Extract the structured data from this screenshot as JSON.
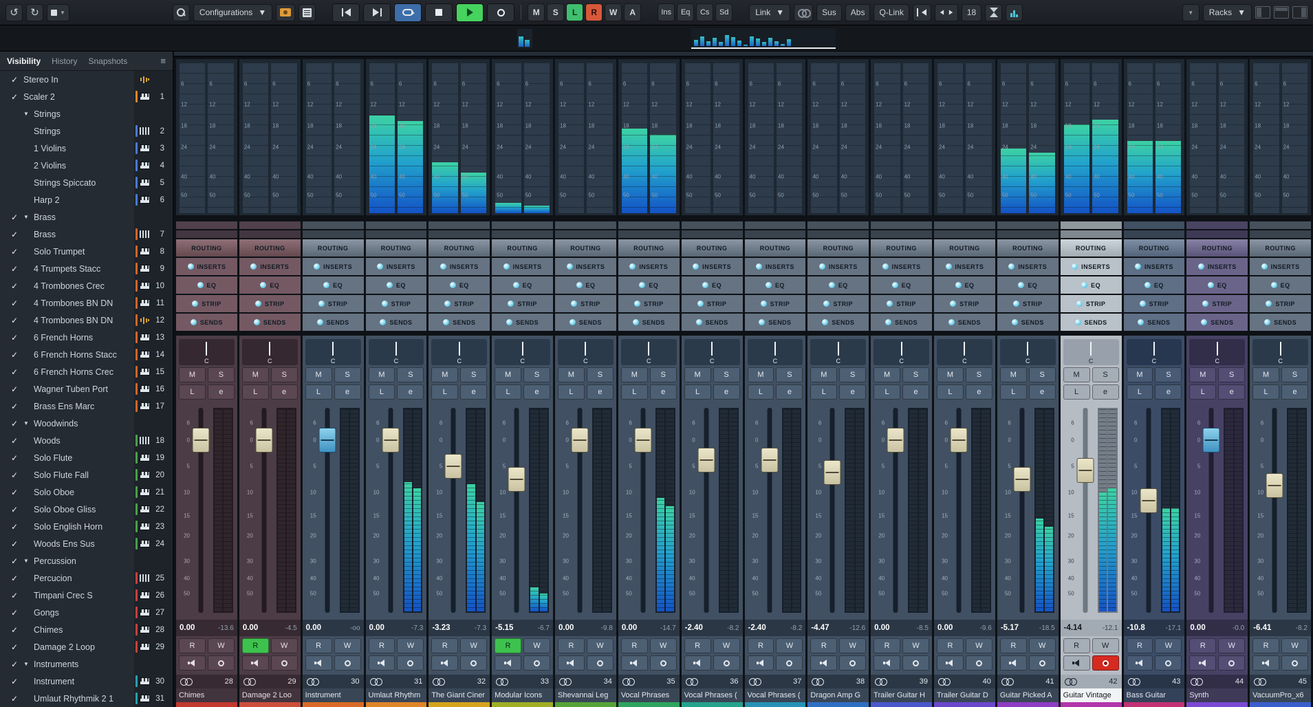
{
  "toolbar": {
    "configurations": "Configurations",
    "link": "Link",
    "sus": "Sus",
    "abs": "Abs",
    "qlink": "Q-Link",
    "position_value": "18",
    "racks": "Racks",
    "channel_btns": [
      {
        "label": "M",
        "state": "off"
      },
      {
        "label": "S",
        "state": "off"
      },
      {
        "label": "L",
        "state": "green"
      },
      {
        "label": "R",
        "state": "orange"
      },
      {
        "label": "W",
        "state": "off"
      },
      {
        "label": "A",
        "state": "off"
      }
    ],
    "rack_btns": [
      "Ins",
      "Eq",
      "Cs",
      "Sd"
    ]
  },
  "minimeters": {
    "small": [
      62,
      40
    ],
    "large": [
      38,
      60,
      30,
      52,
      24,
      68,
      55,
      34,
      10,
      58,
      44,
      24,
      50,
      30,
      14,
      42
    ]
  },
  "sidebar": {
    "tabs": [
      {
        "label": "Visibility",
        "active": true
      },
      {
        "label": "History",
        "active": false
      },
      {
        "label": "Snapshots",
        "active": false
      }
    ],
    "tracks": [
      {
        "name": "Stereo In",
        "num": "",
        "checked": true,
        "folder": false,
        "child": false,
        "icon": "wave",
        "color": ""
      },
      {
        "name": "Scaler 2",
        "num": "1",
        "checked": true,
        "folder": false,
        "child": false,
        "icon": "keys",
        "color": "#e8832a"
      },
      {
        "name": "Strings",
        "num": "",
        "checked": false,
        "folder": true,
        "child": false,
        "icon": "",
        "color": ""
      },
      {
        "name": "Strings",
        "num": "2",
        "checked": false,
        "folder": false,
        "child": true,
        "icon": "organ",
        "color": "#4a7ad0"
      },
      {
        "name": "1 Violins",
        "num": "3",
        "checked": false,
        "folder": false,
        "child": true,
        "icon": "keys",
        "color": "#4a7ad0"
      },
      {
        "name": "2 Violins",
        "num": "4",
        "checked": false,
        "folder": false,
        "child": true,
        "icon": "keys",
        "color": "#4a7ad0"
      },
      {
        "name": "Strings Spiccato",
        "num": "5",
        "checked": false,
        "folder": false,
        "child": true,
        "icon": "keys",
        "color": "#4a7ad0"
      },
      {
        "name": "Harp 2",
        "num": "6",
        "checked": false,
        "folder": false,
        "child": true,
        "icon": "keys",
        "color": "#4a7ad0"
      },
      {
        "name": "Brass",
        "num": "",
        "checked": true,
        "folder": true,
        "child": false,
        "icon": "",
        "color": ""
      },
      {
        "name": "Brass",
        "num": "7",
        "checked": true,
        "folder": false,
        "child": true,
        "icon": "organ",
        "color": "#d0662a"
      },
      {
        "name": "Solo Trumpet",
        "num": "8",
        "checked": true,
        "folder": false,
        "child": true,
        "icon": "keys",
        "color": "#d0662a"
      },
      {
        "name": "4 Trumpets Stacc",
        "num": "9",
        "checked": true,
        "folder": false,
        "child": true,
        "icon": "keys",
        "color": "#d0662a"
      },
      {
        "name": "4 Trombones Crec",
        "num": "10",
        "checked": true,
        "folder": false,
        "child": true,
        "icon": "keys",
        "color": "#d0662a"
      },
      {
        "name": "4 Trombones BN DN",
        "num": "11",
        "checked": true,
        "folder": false,
        "child": true,
        "icon": "keys",
        "color": "#d0662a"
      },
      {
        "name": "4 Trombones BN DN",
        "num": "12",
        "checked": true,
        "folder": false,
        "child": true,
        "icon": "wave",
        "color": "#d0662a"
      },
      {
        "name": "6 French Horns",
        "num": "13",
        "checked": true,
        "folder": false,
        "child": true,
        "icon": "keys",
        "color": "#d0662a"
      },
      {
        "name": "6 French Horns Stacc",
        "num": "14",
        "checked": true,
        "folder": false,
        "child": true,
        "icon": "keys",
        "color": "#d0662a"
      },
      {
        "name": "6 French Horns Crec",
        "num": "15",
        "checked": true,
        "folder": false,
        "child": true,
        "icon": "keys",
        "color": "#d0662a"
      },
      {
        "name": "Wagner Tuben Port",
        "num": "16",
        "checked": true,
        "folder": false,
        "child": true,
        "icon": "keys",
        "color": "#d0662a"
      },
      {
        "name": "Brass Ens Marc",
        "num": "17",
        "checked": true,
        "folder": false,
        "child": true,
        "icon": "keys",
        "color": "#d0662a"
      },
      {
        "name": "Woodwinds",
        "num": "",
        "checked": true,
        "folder": true,
        "child": false,
        "icon": "",
        "color": ""
      },
      {
        "name": "Woods",
        "num": "18",
        "checked": true,
        "folder": false,
        "child": true,
        "icon": "organ",
        "color": "#4aa048"
      },
      {
        "name": "Solo Flute",
        "num": "19",
        "checked": true,
        "folder": false,
        "child": true,
        "icon": "keys",
        "color": "#4aa048"
      },
      {
        "name": "Solo Flute Fall",
        "num": "20",
        "checked": true,
        "folder": false,
        "child": true,
        "icon": "keys",
        "color": "#4aa048"
      },
      {
        "name": "Solo Oboe",
        "num": "21",
        "checked": true,
        "folder": false,
        "child": true,
        "icon": "keys",
        "color": "#4aa048"
      },
      {
        "name": "Solo Oboe Gliss",
        "num": "22",
        "checked": true,
        "folder": false,
        "child": true,
        "icon": "keys",
        "color": "#4aa048"
      },
      {
        "name": "Solo English Horn",
        "num": "23",
        "checked": true,
        "folder": false,
        "child": true,
        "icon": "keys",
        "color": "#4aa048"
      },
      {
        "name": "Woods Ens Sus",
        "num": "24",
        "checked": true,
        "folder": false,
        "child": true,
        "icon": "keys",
        "color": "#4aa048"
      },
      {
        "name": "Percussion",
        "num": "",
        "checked": true,
        "folder": true,
        "child": false,
        "icon": "",
        "color": ""
      },
      {
        "name": "Percucion",
        "num": "25",
        "checked": true,
        "folder": false,
        "child": true,
        "icon": "organ",
        "color": "#c84038"
      },
      {
        "name": "Timpani Crec S",
        "num": "26",
        "checked": true,
        "folder": false,
        "child": true,
        "icon": "keys",
        "color": "#c84038"
      },
      {
        "name": "Gongs",
        "num": "27",
        "checked": true,
        "folder": false,
        "child": true,
        "icon": "keys",
        "color": "#c84038"
      },
      {
        "name": "Chimes",
        "num": "28",
        "checked": true,
        "folder": false,
        "child": true,
        "icon": "keys",
        "color": "#c84038"
      },
      {
        "name": "Damage 2  Loop",
        "num": "29",
        "checked": true,
        "folder": false,
        "child": true,
        "icon": "keys",
        "color": "#c84038"
      },
      {
        "name": "Instruments",
        "num": "",
        "checked": true,
        "folder": true,
        "child": false,
        "icon": "",
        "color": ""
      },
      {
        "name": "Instrument",
        "num": "30",
        "checked": true,
        "folder": false,
        "child": true,
        "icon": "keys",
        "color": "#2a9fae"
      },
      {
        "name": "Umlaut Rhythmik 2 1",
        "num": "31",
        "checked": true,
        "folder": false,
        "child": true,
        "icon": "keys",
        "color": "#2a9fae"
      }
    ]
  },
  "mixer": {
    "strip_labels": {
      "mute": "M",
      "solo": "S",
      "listen": "L",
      "edit": "e",
      "read": "R",
      "write": "W"
    },
    "rack_rows": [
      {
        "label": "ROUTING",
        "dot": false,
        "header": true
      },
      {
        "label": "INSERTS",
        "dot": true,
        "header": false
      },
      {
        "label": "EQ",
        "dot": true,
        "header": false
      },
      {
        "label": "STRIP",
        "dot": true,
        "header": false
      },
      {
        "label": "SENDS",
        "dot": true,
        "header": false
      }
    ],
    "meter_scale": [
      {
        "t": "6",
        "p": 14
      },
      {
        "t": "12",
        "p": 28
      },
      {
        "t": "18",
        "p": 42
      },
      {
        "t": "24",
        "p": 56
      },
      {
        "t": "40",
        "p": 76
      },
      {
        "t": "50",
        "p": 88
      }
    ],
    "fader_scale": [
      {
        "t": "6",
        "p": 9
      },
      {
        "t": "0",
        "p": 17
      },
      {
        "t": "5",
        "p": 29
      },
      {
        "t": "10",
        "p": 41
      },
      {
        "t": "15",
        "p": 52
      },
      {
        "t": "20",
        "p": 61
      },
      {
        "t": "30",
        "p": 73
      },
      {
        "t": "40",
        "p": 81
      },
      {
        "t": "50",
        "p": 88
      }
    ],
    "channels": [
      {
        "name": "Chimes",
        "num": "28",
        "pan": "C",
        "vol": "0.00",
        "peak": "-13.6",
        "fader": 17,
        "cap": "beige",
        "meters": [
          0,
          0
        ],
        "bridge": [
          0,
          0
        ],
        "tint": "maroon",
        "color": "#c23a30",
        "r_on": false,
        "rec_on": false,
        "selected": false
      },
      {
        "name": "Damage 2  Loo",
        "num": "29",
        "pan": "C",
        "vol": "0.00",
        "peak": "-4.5",
        "fader": 17,
        "cap": "beige",
        "meters": [
          0,
          0
        ],
        "bridge": [
          0,
          0
        ],
        "tint": "maroon",
        "color": "#cc4f3c",
        "r_on": true,
        "rec_on": false,
        "selected": false
      },
      {
        "name": "Instrument",
        "num": "30",
        "pan": "C",
        "vol": "0.00",
        "peak": "-oo",
        "fader": 17,
        "cap": "blue",
        "meters": [
          0,
          0
        ],
        "bridge": [
          0,
          0
        ],
        "tint": "default",
        "color": "#d96a28",
        "r_on": false,
        "rec_on": false,
        "selected": false
      },
      {
        "name": "Umlaut Rhythm",
        "num": "31",
        "pan": "C",
        "vol": "0.00",
        "peak": "-7.3",
        "fader": 17,
        "cap": "beige",
        "meters": [
          64,
          61
        ],
        "bridge": [
          65,
          61
        ],
        "tint": "default",
        "color": "#e08428",
        "r_on": false,
        "rec_on": false,
        "selected": false
      },
      {
        "name": "The Giant Ciner",
        "num": "32",
        "pan": "C",
        "vol": "-3.23",
        "peak": "-7.3",
        "fader": 29,
        "cap": "beige",
        "meters": [
          63,
          54
        ],
        "bridge": [
          34,
          27
        ],
        "tint": "default",
        "color": "#d4a41c",
        "r_on": false,
        "rec_on": false,
        "selected": false
      },
      {
        "name": "Modular Icons",
        "num": "33",
        "pan": "C",
        "vol": "-5.15",
        "peak": "-6.7",
        "fader": 35,
        "cap": "beige",
        "meters": [
          12,
          9
        ],
        "bridge": [
          7,
          5
        ],
        "tint": "default",
        "color": "#9fae24",
        "r_on": true,
        "rec_on": false,
        "selected": false
      },
      {
        "name": "Shevannai Leg",
        "num": "34",
        "pan": "C",
        "vol": "0.00",
        "peak": "-9.8",
        "fader": 17,
        "cap": "beige",
        "meters": [
          0,
          0
        ],
        "bridge": [
          0,
          0
        ],
        "tint": "default",
        "color": "#56a438",
        "r_on": false,
        "rec_on": false,
        "selected": false
      },
      {
        "name": "Vocal Phrases",
        "num": "35",
        "pan": "C",
        "vol": "0.00",
        "peak": "-14.7",
        "fader": 17,
        "cap": "beige",
        "meters": [
          56,
          52
        ],
        "bridge": [
          56,
          52
        ],
        "tint": "default",
        "color": "#2ea55e",
        "r_on": false,
        "rec_on": false,
        "selected": false
      },
      {
        "name": "Vocal Phrases (",
        "num": "36",
        "pan": "C",
        "vol": "-2.40",
        "peak": "-8.2",
        "fader": 26,
        "cap": "beige",
        "meters": [
          0,
          0
        ],
        "bridge": [
          0,
          0
        ],
        "tint": "default",
        "color": "#26a38c",
        "r_on": false,
        "rec_on": false,
        "selected": false
      },
      {
        "name": "Vocal Phrases (",
        "num": "37",
        "pan": "C",
        "vol": "-2.40",
        "peak": "-8.2",
        "fader": 26,
        "cap": "beige",
        "meters": [
          0,
          0
        ],
        "bridge": [
          0,
          0
        ],
        "tint": "default",
        "color": "#2792b4",
        "r_on": false,
        "rec_on": false,
        "selected": false
      },
      {
        "name": "Dragon Amp G",
        "num": "38",
        "pan": "C",
        "vol": "-4.47",
        "peak": "-12.6",
        "fader": 32,
        "cap": "beige",
        "meters": [
          0,
          0
        ],
        "bridge": [
          0,
          0
        ],
        "tint": "default",
        "color": "#2f6fc4",
        "r_on": false,
        "rec_on": false,
        "selected": false
      },
      {
        "name": "Trailer Guitar H",
        "num": "39",
        "pan": "C",
        "vol": "0.00",
        "peak": "-8.5",
        "fader": 17,
        "cap": "beige",
        "meters": [
          0,
          0
        ],
        "bridge": [
          0,
          0
        ],
        "tint": "default",
        "color": "#4a58cc",
        "r_on": false,
        "rec_on": false,
        "selected": false
      },
      {
        "name": "Trailer Guitar D",
        "num": "40",
        "pan": "C",
        "vol": "0.00",
        "peak": "-9.6",
        "fader": 17,
        "cap": "beige",
        "meters": [
          0,
          0
        ],
        "bridge": [
          0,
          0
        ],
        "tint": "default",
        "color": "#6a48cc",
        "r_on": false,
        "rec_on": false,
        "selected": false
      },
      {
        "name": "Guitar Picked A",
        "num": "41",
        "pan": "C",
        "vol": "-5.17",
        "peak": "-18.5",
        "fader": 35,
        "cap": "beige",
        "meters": [
          46,
          42
        ],
        "bridge": [
          43,
          40
        ],
        "tint": "default",
        "color": "#8e3cc4",
        "r_on": false,
        "rec_on": false,
        "selected": false
      },
      {
        "name": "Guitar Vintage",
        "num": "42",
        "pan": "C",
        "vol": "-4.14",
        "peak": "-12.1",
        "fader": 31,
        "cap": "beige",
        "meters": [
          59,
          61
        ],
        "bridge": [
          59,
          62
        ],
        "tint": "selected",
        "color": "#b236aa",
        "r_on": false,
        "rec_on": true,
        "selected": true
      },
      {
        "name": "Bass Guitar",
        "num": "43",
        "pan": "C",
        "vol": "-10.8",
        "peak": "-17.1",
        "fader": 45,
        "cap": "beige",
        "meters": [
          51,
          51
        ],
        "bridge": [
          48,
          48
        ],
        "tint": "navy",
        "color": "#c23274",
        "r_on": false,
        "rec_on": false,
        "selected": false
      },
      {
        "name": "Synth",
        "num": "44",
        "pan": "C",
        "vol": "0.00",
        "peak": "-0.0",
        "fader": 17,
        "cap": "blue",
        "meters": [
          0,
          0
        ],
        "bridge": [
          0,
          0
        ],
        "tint": "purple",
        "color": "#7a4ad2",
        "r_on": false,
        "rec_on": false,
        "selected": false
      },
      {
        "name": "VacuumPro_x6",
        "num": "45",
        "pan": "C",
        "vol": "-6.41",
        "peak": "-8.2",
        "fader": 38,
        "cap": "beige",
        "meters": [
          0,
          0
        ],
        "bridge": [
          0,
          0
        ],
        "tint": "default",
        "color": "#3a5ecc",
        "r_on": false,
        "rec_on": false,
        "selected": false
      }
    ]
  }
}
